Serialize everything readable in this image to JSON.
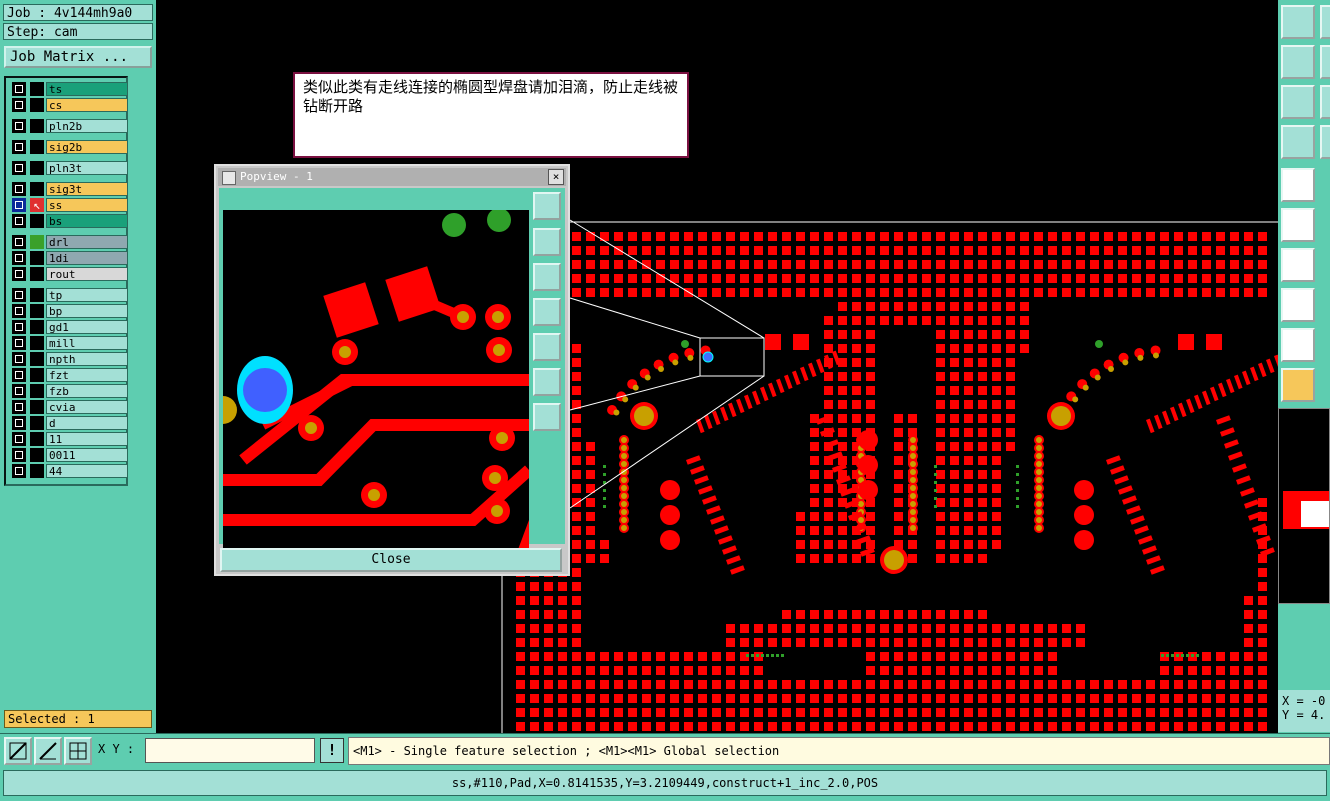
{
  "job": {
    "label": "Job : 4v144mh9a0",
    "step": "Step: cam",
    "matrix_button": "Job Matrix ..."
  },
  "layers": [
    {
      "name": "ts",
      "color": "#1aa07a",
      "mark": ""
    },
    {
      "name": "cs",
      "color": "#f6c75a",
      "mark": ""
    },
    {
      "name": "pln2b",
      "color": "#a3e0d6",
      "mark": ""
    },
    {
      "name": "sig2b",
      "color": "#f6c75a",
      "mark": ""
    },
    {
      "name": "pln3t",
      "color": "#a3e0d6",
      "mark": ""
    },
    {
      "name": "sig3t",
      "color": "#f6c75a",
      "mark": ""
    },
    {
      "name": "ss",
      "color": "#f6c75a",
      "mark": "work-layer-arrow"
    },
    {
      "name": "bs",
      "color": "#1aa07a",
      "mark": ""
    },
    {
      "name": "drl",
      "color": "#8fa8b0",
      "mark": "green"
    },
    {
      "name": "1di",
      "color": "#8fa8b0",
      "mark": ""
    },
    {
      "name": "rout",
      "color": "#d8d8d8",
      "mark": ""
    },
    {
      "name": "tp",
      "color": "#a3e0d6",
      "mark": ""
    },
    {
      "name": "bp",
      "color": "#a3e0d6",
      "mark": ""
    },
    {
      "name": "gd1",
      "color": "#a3e0d6",
      "mark": ""
    },
    {
      "name": "mill",
      "color": "#a3e0d6",
      "mark": ""
    },
    {
      "name": "npth",
      "color": "#a3e0d6",
      "mark": ""
    },
    {
      "name": "fzt",
      "color": "#a3e0d6",
      "mark": ""
    },
    {
      "name": "fzb",
      "color": "#a3e0d6",
      "mark": ""
    },
    {
      "name": "cvia",
      "color": "#a3e0d6",
      "mark": ""
    },
    {
      "name": "d",
      "color": "#a3e0d6",
      "mark": ""
    },
    {
      "name": "11",
      "color": "#a3e0d6",
      "mark": ""
    },
    {
      "name": "0011",
      "color": "#a3e0d6",
      "mark": ""
    },
    {
      "name": "44",
      "color": "#a3e0d6",
      "mark": ""
    }
  ],
  "selected": "Selected : 1",
  "note": "类似此类有走线连接的椭圆型焊盘请加泪滴，防止走线被钻断开路",
  "popview": {
    "title": "Popview - 1",
    "close_label": "Close",
    "close_x": "×"
  },
  "cmd": {
    "xy_label": "X Y :",
    "xy_value": "",
    "warn": "!",
    "hint": "<M1> - Single feature selection ; <M1><M1> Global selection"
  },
  "coords": {
    "x": "X = -0",
    "y": "Y = 4."
  },
  "status": "ss,#110,Pad,X=0.8141535,Y=3.2109449,construct+1_inc_2.0,POS",
  "colors": {
    "panel": "#5ecdb0",
    "copper": "#ff0000",
    "drill": "#c8a000"
  }
}
